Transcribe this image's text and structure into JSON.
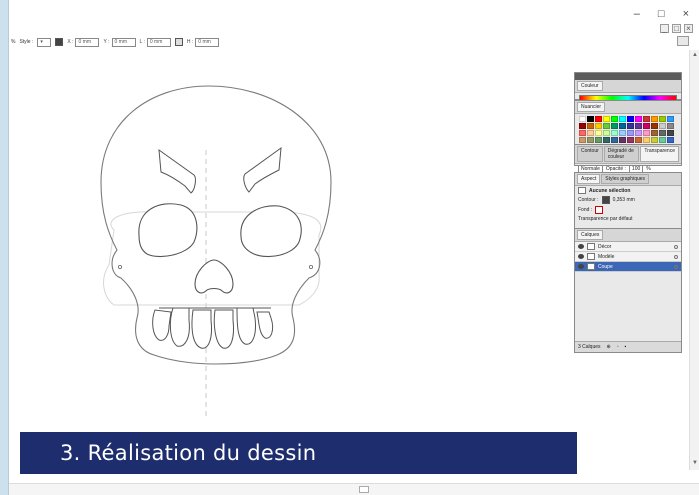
{
  "window": {
    "minimize_label": "–",
    "maximize_label": "□",
    "close_label": "×"
  },
  "control_bar": {
    "style_label": "Style :",
    "fields": [
      {
        "label": "X :",
        "value": "0 mm"
      },
      {
        "label": "Y :",
        "value": "0 mm"
      },
      {
        "label": "L :",
        "value": "0 mm"
      },
      {
        "label": "H :",
        "value": "0 mm"
      }
    ]
  },
  "panels": {
    "color": {
      "tab": "Couleur"
    },
    "swatches": {
      "tab": "Nuancier",
      "colors": [
        "#ffffff",
        "#000000",
        "#ff0000",
        "#ffff00",
        "#00ff00",
        "#00ffff",
        "#0000ff",
        "#ff00ff",
        "#cc3333",
        "#ff9900",
        "#99cc00",
        "#3399ff",
        "#990000",
        "#cc6600",
        "#ffcc00",
        "#66cc33",
        "#009966",
        "#006699",
        "#333399",
        "#663399",
        "#cc0066",
        "#993300",
        "#cccccc",
        "#888888",
        "#ff6666",
        "#ffcc99",
        "#ffff99",
        "#ccff99",
        "#99ffcc",
        "#99ccff",
        "#9999ff",
        "#cc99ff",
        "#ff99cc",
        "#996633",
        "#666666",
        "#444444",
        "#cc9966",
        "#999966",
        "#669966",
        "#336666",
        "#336699",
        "#663366",
        "#993366",
        "#cc6633",
        "#ffcc66",
        "#cccc33",
        "#66cc99",
        "#3366cc"
      ]
    },
    "transparency": {
      "tabs": [
        "Contour",
        "Dégradé de couleur",
        "Transparence"
      ],
      "mode": "Normale",
      "opacity_label": "Opacité :",
      "opacity_value": "100",
      "opacity_unit": "%"
    },
    "aspect": {
      "tabs": [
        "Aspect",
        "Styles graphiques"
      ],
      "header": "Aucune sélection",
      "contour_label": "Contour :",
      "contour_value": "0,353 mm",
      "fond_label": "Fond :",
      "transparency_label": "Transparence par défaut"
    },
    "layers": {
      "tab": "Calques",
      "items": [
        {
          "name": "Décor",
          "selected": false
        },
        {
          "name": "Modèle",
          "selected": false
        },
        {
          "name": "Coupe",
          "selected": true
        }
      ],
      "count": "3 Calques"
    }
  },
  "caption": "3. Réalisation du dessin"
}
